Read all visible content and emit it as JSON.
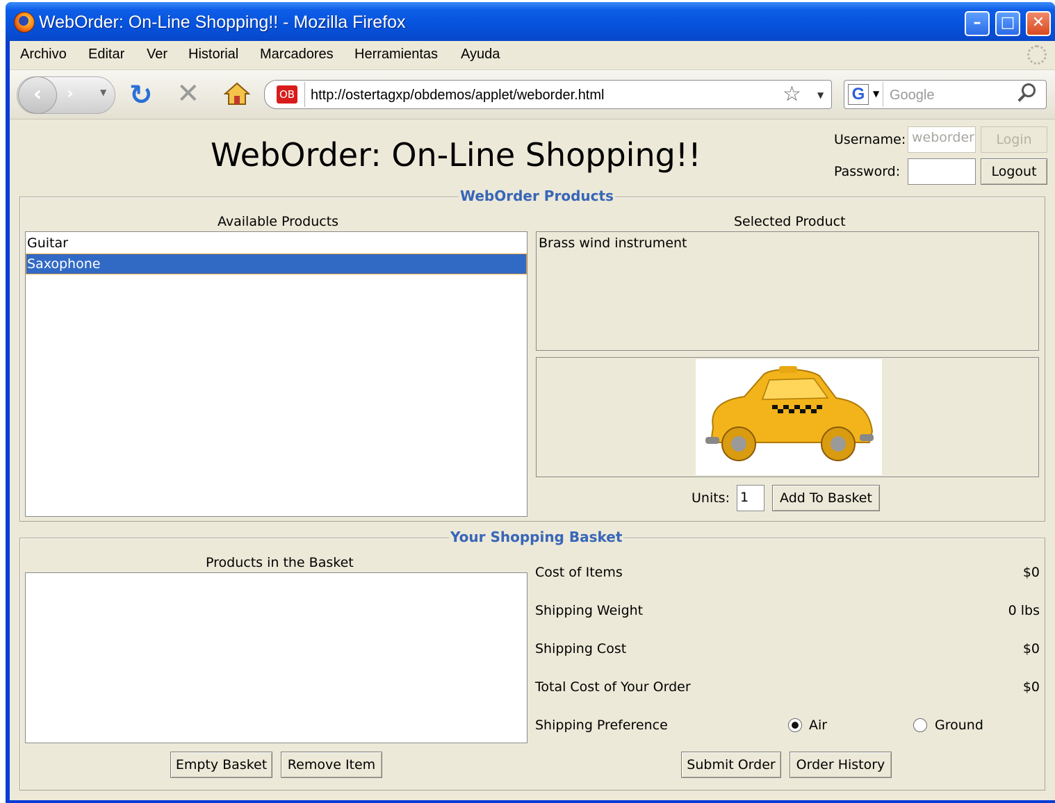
{
  "window": {
    "title": "WebOrder: On-Line Shopping!! - Mozilla Firefox"
  },
  "menu": [
    "Archivo",
    "Editar",
    "Ver",
    "Historial",
    "Marcadores",
    "Herramientas",
    "Ayuda"
  ],
  "nav": {
    "url": "http://ostertagxp/obdemos/applet/weborder.html",
    "site_badge": "OB",
    "search_placeholder": "Google",
    "search_engine_icon": "G"
  },
  "header": {
    "title": "WebOrder: On-Line Shopping!!",
    "username_label": "Username:",
    "username_value": "weborder",
    "password_label": "Password:",
    "password_value": "",
    "login_label": "Login",
    "logout_label": "Logout"
  },
  "products": {
    "legend": "WebOrder Products",
    "available_label": "Available Products",
    "items": [
      {
        "name": "Guitar",
        "selected": false
      },
      {
        "name": "Saxophone",
        "selected": true
      }
    ],
    "selected_label": "Selected Product",
    "description": "Brass wind instrument",
    "image_icon": "taxi-car-image",
    "units_label": "Units:",
    "units_value": "1",
    "add_label": "Add To Basket"
  },
  "basket": {
    "legend": "Your Shopping Basket",
    "list_label": "Products in the Basket",
    "items": [],
    "rows": [
      {
        "label": "Cost of Items",
        "value": "$0"
      },
      {
        "label": "Shipping Weight",
        "value": "0 lbs"
      },
      {
        "label": "Shipping Cost",
        "value": "$0"
      },
      {
        "label": "Total Cost of Your Order",
        "value": "$0"
      }
    ],
    "shipping_pref_label": "Shipping Preference",
    "shipping_options": [
      {
        "label": "Air",
        "checked": true
      },
      {
        "label": "Ground",
        "checked": false
      }
    ],
    "empty_label": "Empty Basket",
    "remove_label": "Remove Item",
    "submit_label": "Submit Order",
    "history_label": "Order History"
  },
  "colors": {
    "legend": "#3866b8",
    "selection": "#316ac5",
    "titlebar": "#0552dc",
    "background": "#ece9d8"
  }
}
